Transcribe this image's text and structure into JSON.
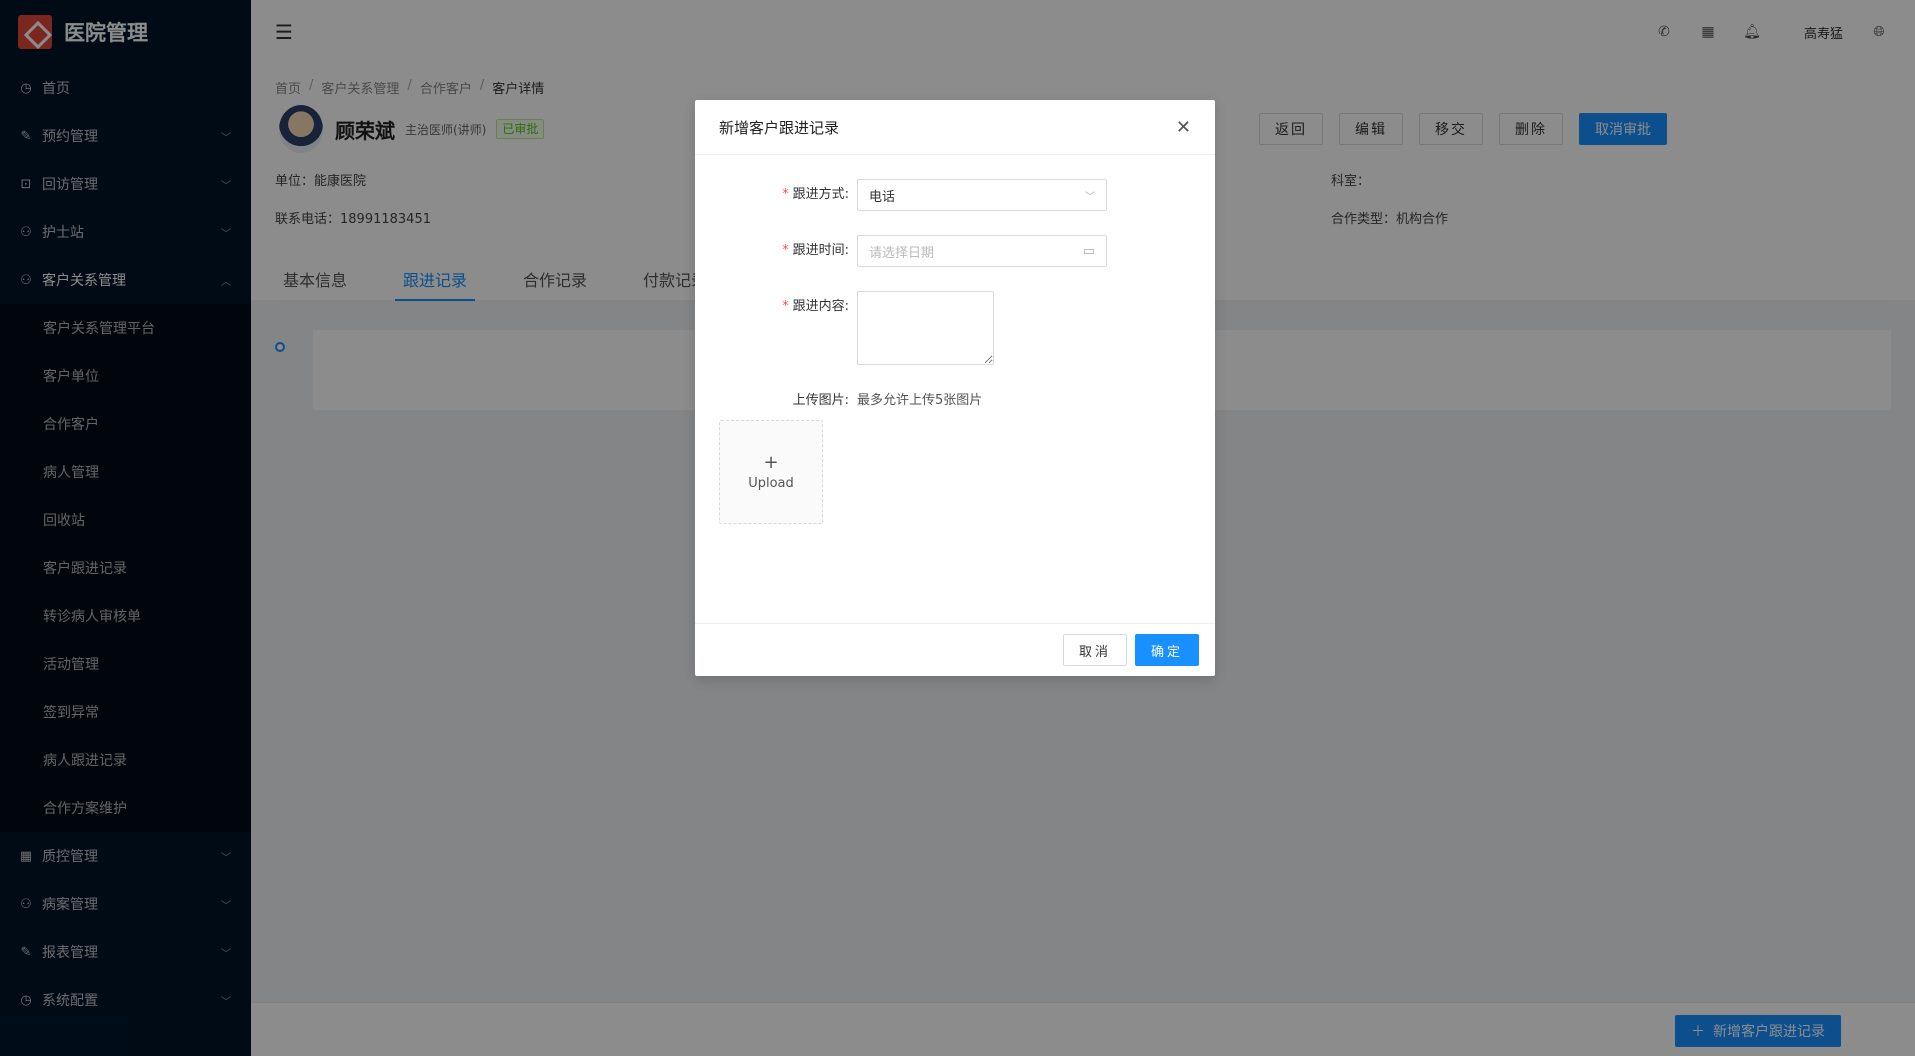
{
  "app": {
    "title": "医院管理"
  },
  "sidebar": {
    "items": [
      {
        "label": "首页",
        "icon": "dashboard-icon",
        "glyph": "◷"
      },
      {
        "label": "预约管理",
        "icon": "edit-icon",
        "glyph": "✎"
      },
      {
        "label": "回访管理",
        "icon": "lock-icon",
        "glyph": "⊡"
      },
      {
        "label": "护士站",
        "icon": "user-icon",
        "glyph": "⚇"
      },
      {
        "label": "客户关系管理",
        "icon": "user-icon",
        "glyph": "⚇"
      },
      {
        "label": "质控管理",
        "icon": "table-icon",
        "glyph": "▦"
      },
      {
        "label": "病案管理",
        "icon": "user-icon",
        "glyph": "⚇"
      },
      {
        "label": "报表管理",
        "icon": "edit-icon",
        "glyph": "✎"
      },
      {
        "label": "系统配置",
        "icon": "dashboard-icon",
        "glyph": "◷"
      }
    ],
    "submenu": [
      "客户关系管理平台",
      "客户单位",
      "合作客户",
      "病人管理",
      "回收站",
      "客户跟进记录",
      "转诊病人审核单",
      "活动管理",
      "签到异常",
      "病人跟进记录",
      "合作方案维护"
    ]
  },
  "header": {
    "username": "高寿猛"
  },
  "breadcrumb": [
    "首页",
    "客户关系管理",
    "合作客户",
    "客户详情"
  ],
  "profile": {
    "name": "顾荣斌",
    "role": "主治医师(讲师)",
    "badge": "已审批",
    "unit_label": "单位：",
    "unit": "能康医院",
    "phone_label": "联系电话：",
    "phone": "18991183451",
    "dept_label": "科室：",
    "dept": "",
    "coop_label": "合作类型：",
    "coop": "机构合作"
  },
  "actions": {
    "back": "返回",
    "edit": "编辑",
    "transfer": "移交",
    "delete": "删除",
    "cancel_approval": "取消审批"
  },
  "tabs": [
    {
      "label": "基本信息"
    },
    {
      "label": "跟进记录"
    },
    {
      "label": "合作记录"
    },
    {
      "label": "付款记录"
    }
  ],
  "bottom": {
    "add_label": "新增客户跟进记录"
  },
  "modal": {
    "title": "新增客户跟进记录",
    "method_label": "跟进方式:",
    "method_value": "电话",
    "time_label": "跟进时间:",
    "time_placeholder": "请选择日期",
    "content_label": "跟进内容:",
    "upload_label": "上传图片:",
    "upload_hint": "最多允许上传5张图片",
    "upload_text": "Upload",
    "cancel": "取消",
    "ok": "确定"
  }
}
